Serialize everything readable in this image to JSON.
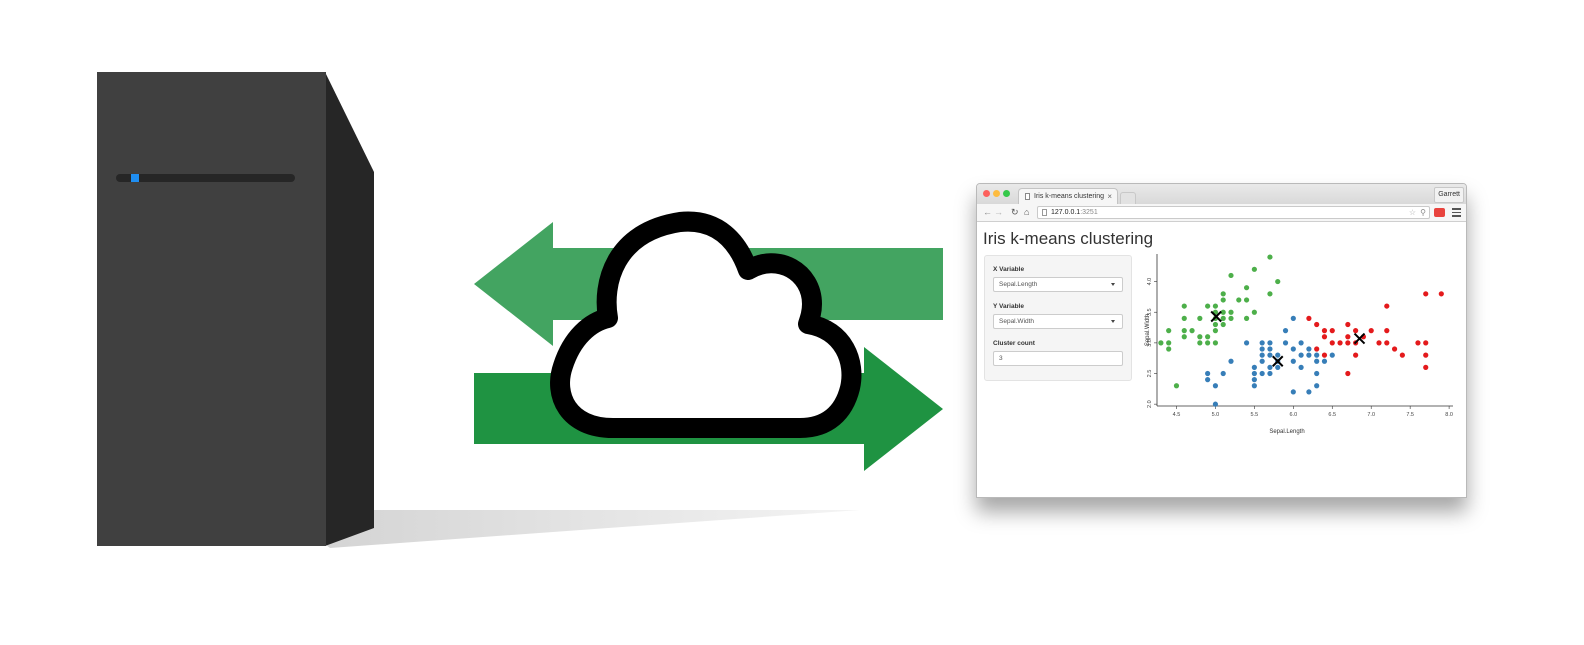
{
  "browser": {
    "tab_title": "Iris k-means clustering",
    "tab_close": "×",
    "profile_name": "Garrett",
    "url_host": "127.0.0.1",
    "url_port": ":3251"
  },
  "app": {
    "title": "Iris k-means clustering",
    "x_variable": {
      "label": "X Variable",
      "value": "Sepal.Length"
    },
    "y_variable": {
      "label": "Y Variable",
      "value": "Sepal.Width"
    },
    "cluster_count": {
      "label": "Cluster count",
      "value": "3"
    }
  },
  "icons": {
    "server": "server-icon",
    "cloud": "cloud-icon",
    "upload_arrow": "arrow-left-icon",
    "download_arrow": "arrow-right-icon"
  },
  "colors": {
    "server_front": "#404040",
    "server_side": "#262626",
    "server_led": "#1f8ef1",
    "arrow_upper": "#43a461",
    "arrow_lower": "#1f9342",
    "cluster_green": "#4daf4a",
    "cluster_blue": "#377eb8",
    "cluster_red": "#e41a1c"
  },
  "chart_data": {
    "type": "scatter",
    "xlabel": "Sepal.Length",
    "ylabel": "Sepal.Width",
    "xlim": [
      4.25,
      8.05
    ],
    "ylim": [
      1.97,
      4.45
    ],
    "xticks": [
      "4.5",
      "5.0",
      "5.5",
      "6.0",
      "6.5",
      "7.0",
      "7.5",
      "8.0"
    ],
    "yticks": [
      "2.0",
      "2.5",
      "3.0",
      "3.5",
      "4.0"
    ],
    "series": [
      {
        "color": "#4daf4a",
        "points": [
          [
            4.3,
            3.0
          ],
          [
            4.4,
            2.9
          ],
          [
            4.4,
            3.0
          ],
          [
            4.4,
            3.2
          ],
          [
            4.5,
            2.3
          ],
          [
            4.6,
            3.1
          ],
          [
            4.6,
            3.4
          ],
          [
            4.6,
            3.6
          ],
          [
            4.6,
            3.2
          ],
          [
            4.7,
            3.2
          ],
          [
            4.8,
            3.0
          ],
          [
            4.8,
            3.1
          ],
          [
            4.8,
            3.4
          ],
          [
            4.9,
            3.0
          ],
          [
            4.9,
            3.1
          ],
          [
            4.9,
            3.6
          ],
          [
            5.0,
            3.0
          ],
          [
            5.0,
            3.2
          ],
          [
            5.0,
            3.3
          ],
          [
            5.0,
            3.4
          ],
          [
            5.0,
            3.5
          ],
          [
            5.0,
            3.6
          ],
          [
            5.1,
            3.3
          ],
          [
            5.1,
            3.4
          ],
          [
            5.1,
            3.5
          ],
          [
            5.1,
            3.7
          ],
          [
            5.1,
            3.8
          ],
          [
            5.2,
            3.4
          ],
          [
            5.2,
            3.5
          ],
          [
            5.2,
            4.1
          ],
          [
            5.3,
            3.7
          ],
          [
            5.4,
            3.4
          ],
          [
            5.4,
            3.7
          ],
          [
            5.4,
            3.9
          ],
          [
            5.5,
            3.5
          ],
          [
            5.5,
            4.2
          ],
          [
            5.7,
            3.8
          ],
          [
            5.7,
            4.4
          ],
          [
            5.8,
            4.0
          ]
        ],
        "center": [
          5.01,
          3.43
        ]
      },
      {
        "color": "#377eb8",
        "points": [
          [
            4.9,
            2.5
          ],
          [
            4.9,
            2.4
          ],
          [
            5.0,
            2.0
          ],
          [
            5.0,
            2.3
          ],
          [
            5.1,
            2.5
          ],
          [
            5.2,
            2.7
          ],
          [
            5.4,
            3.0
          ],
          [
            5.5,
            2.3
          ],
          [
            5.5,
            2.4
          ],
          [
            5.5,
            2.5
          ],
          [
            5.5,
            2.6
          ],
          [
            5.6,
            2.5
          ],
          [
            5.6,
            2.7
          ],
          [
            5.6,
            2.8
          ],
          [
            5.6,
            2.9
          ],
          [
            5.6,
            3.0
          ],
          [
            5.7,
            2.5
          ],
          [
            5.7,
            2.6
          ],
          [
            5.7,
            2.8
          ],
          [
            5.7,
            2.9
          ],
          [
            5.7,
            3.0
          ],
          [
            5.8,
            2.6
          ],
          [
            5.8,
            2.7
          ],
          [
            5.8,
            2.8
          ],
          [
            5.9,
            3.0
          ],
          [
            5.9,
            3.2
          ],
          [
            6.0,
            2.2
          ],
          [
            6.0,
            2.7
          ],
          [
            6.0,
            2.9
          ],
          [
            6.0,
            3.4
          ],
          [
            6.1,
            2.6
          ],
          [
            6.1,
            2.8
          ],
          [
            6.1,
            3.0
          ],
          [
            6.2,
            2.2
          ],
          [
            6.2,
            2.8
          ],
          [
            6.2,
            2.9
          ],
          [
            6.3,
            2.3
          ],
          [
            6.3,
            2.5
          ],
          [
            6.3,
            2.7
          ],
          [
            6.4,
            2.7
          ],
          [
            6.5,
            2.8
          ],
          [
            6.3,
            2.8
          ]
        ],
        "center": [
          5.8,
          2.7
        ]
      },
      {
        "color": "#e41a1c",
        "points": [
          [
            6.2,
            3.4
          ],
          [
            6.3,
            2.9
          ],
          [
            6.3,
            3.3
          ],
          [
            6.4,
            2.8
          ],
          [
            6.4,
            3.1
          ],
          [
            6.4,
            3.2
          ],
          [
            6.5,
            3.0
          ],
          [
            6.5,
            3.2
          ],
          [
            6.6,
            3.0
          ],
          [
            6.7,
            2.5
          ],
          [
            6.7,
            3.0
          ],
          [
            6.7,
            3.1
          ],
          [
            6.7,
            3.3
          ],
          [
            6.8,
            2.8
          ],
          [
            6.8,
            3.0
          ],
          [
            6.8,
            3.2
          ],
          [
            6.9,
            3.1
          ],
          [
            7.0,
            3.2
          ],
          [
            7.1,
            3.0
          ],
          [
            7.2,
            3.0
          ],
          [
            7.2,
            3.2
          ],
          [
            7.2,
            3.6
          ],
          [
            7.3,
            2.9
          ],
          [
            7.4,
            2.8
          ],
          [
            7.6,
            3.0
          ],
          [
            7.7,
            2.6
          ],
          [
            7.7,
            2.8
          ],
          [
            7.7,
            3.0
          ],
          [
            7.7,
            3.8
          ],
          [
            7.9,
            3.8
          ]
        ],
        "center": [
          6.85,
          3.07
        ]
      }
    ]
  }
}
